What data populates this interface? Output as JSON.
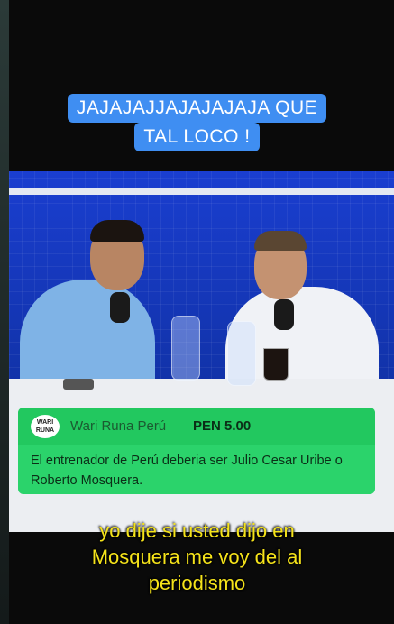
{
  "captions": {
    "top_line_1": "JAJAJAJJAJAJAJAJA QUE",
    "top_line_2": "TAL LOCO !",
    "bottom_line_1": "yo dije si usted dijo en",
    "bottom_line_2": "Mosquera me voy del al",
    "bottom_line_3": "periodismo"
  },
  "donation": {
    "logo_text": "WARI RUNA",
    "donor_name": "Wari Runa Perú",
    "amount": "PEN 5.00",
    "message": "El entrenador de Perú deberia ser Julio Cesar Uribe o Roberto Mosquera."
  },
  "colors": {
    "caption_bg": "#3f8ef2",
    "donation_bg": "#2bd36b",
    "subtitle_text": "#f5e31a"
  }
}
